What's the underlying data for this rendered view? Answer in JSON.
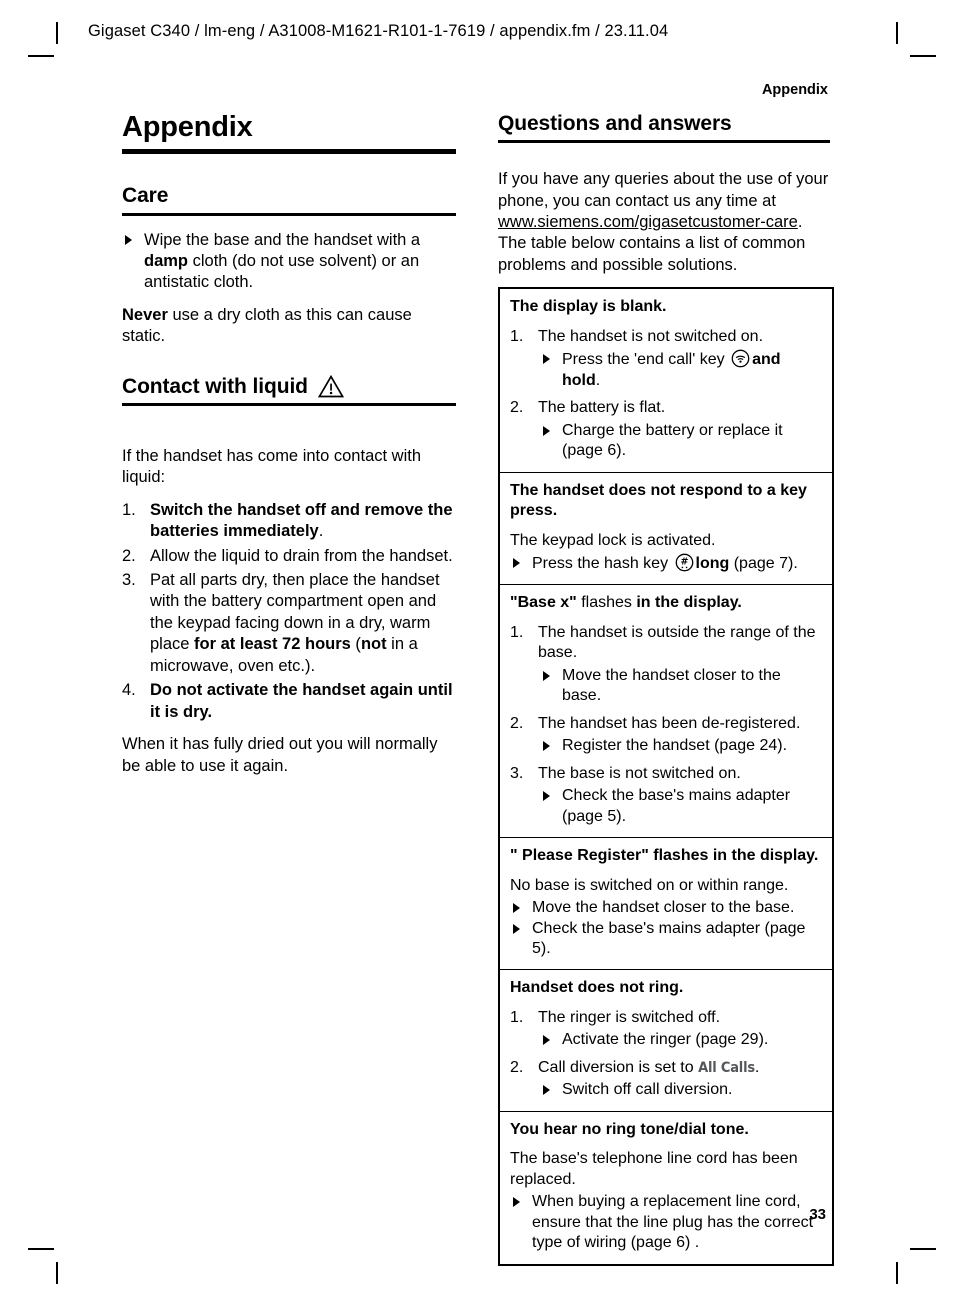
{
  "page": {
    "doc_header": "Gigaset C340 / lm-eng / A31008-M1621-R101-1-7619 / appendix.fm / 23.11.04",
    "running_head": "Appendix",
    "page_number": "33"
  },
  "left_column": {
    "h1": "Appendix",
    "care": {
      "heading": "Care",
      "bullet": {
        "pre": "Wipe the base and the handset with a ",
        "bold": "damp",
        "post": " cloth (do not use solvent) or an antistatic cloth."
      },
      "never": {
        "bold": "Never",
        "post": " use a dry cloth as this can cause static."
      }
    },
    "liquid": {
      "heading": "Contact with liquid",
      "warning_icon": "warning-triangle-icon",
      "intro": "If the handset has come into contact with liquid:",
      "steps": [
        {
          "num": "1.",
          "bold": "Switch the handset off and remove the batteries immediately",
          "post": "."
        },
        {
          "num": "2.",
          "bold": "",
          "post": "Allow the liquid to drain from the handset."
        },
        {
          "num": "3.",
          "bold": "",
          "post": "Pat all parts dry, then place the handset with the battery compartment open and the keypad facing down in a dry, warm place "
        },
        {
          "num": "4.",
          "bold": "Do not activate the handset again until it is dry.",
          "post": ""
        }
      ],
      "step3_bold_a": "for at least 72 hours",
      "step3_mid": " (",
      "step3_bold_b": "not",
      "step3_tail": " in a microwave, oven etc.).",
      "closing": "When it has fully dried out you will normally be able to use it again."
    }
  },
  "right_column": {
    "heading": "Questions and answers",
    "intro": {
      "pre": "If you have any queries about the use of your phone, you can contact us any time at ",
      "link": "www.siemens.com/gigasetcustomer-care",
      "post": ". The table below contains a list of common problems and possible solutions."
    },
    "qa_rows": [
      {
        "title": "The display is blank.",
        "title_plain": "",
        "items": [
          {
            "num": "1.",
            "text": "The handset is not switched on.",
            "subs": [
              {
                "pre": "Press the 'end call' key ",
                "icon": "end-call-key-icon",
                "bold": "and hold",
                "post": "."
              }
            ]
          },
          {
            "num": "2.",
            "text": "The battery is flat.",
            "subs": [
              {
                "pre": "Charge the battery or replace it (page 6).",
                "icon": "",
                "bold": "",
                "post": ""
              }
            ]
          }
        ]
      },
      {
        "title": "The handset does not respond to a key press.",
        "plain": "The keypad lock is activated.",
        "flat_subs": [
          {
            "pre": "Press the hash key ",
            "icon": "hash-key-icon",
            "bold": "long",
            "post": " (page 7)."
          }
        ]
      },
      {
        "title_quoted": "\"Base x\"",
        "title_reg": " flashes ",
        "title_rest": "in the display.",
        "items": [
          {
            "num": "1.",
            "text": "The handset is outside the range of the base.",
            "subs": [
              {
                "pre": "Move the handset closer to the base.",
                "icon": "",
                "bold": "",
                "post": ""
              }
            ]
          },
          {
            "num": "2.",
            "text": "The handset has been de-registered.",
            "subs": [
              {
                "pre": "Register the handset (page 24).",
                "icon": "",
                "bold": "",
                "post": ""
              }
            ]
          },
          {
            "num": "3.",
            "text": "The base is not switched on.",
            "subs": [
              {
                "pre": "Check the base's mains adapter (page 5).",
                "icon": "",
                "bold": "",
                "post": ""
              }
            ]
          }
        ]
      },
      {
        "title": "\" Please Register\" flashes in the display.",
        "plain": "No base is switched on or within range.",
        "flat_subs": [
          {
            "pre": "Move the handset closer to the base.",
            "icon": "",
            "bold": "",
            "post": ""
          },
          {
            "pre": "Check the base's mains adapter (page 5).",
            "icon": "",
            "bold": "",
            "post": ""
          }
        ]
      },
      {
        "title": "Handset does not ring.",
        "items": [
          {
            "num": "1.",
            "text": "The ringer is switched off.",
            "subs": [
              {
                "pre": "Activate the ringer (page 29).",
                "icon": "",
                "bold": "",
                "post": ""
              }
            ]
          },
          {
            "num": "2.",
            "text_pre": "Call diversion is set to ",
            "lcd": "All Calls",
            "text_post": ".",
            "subs": [
              {
                "pre": "Switch off call diversion.",
                "icon": "",
                "bold": "",
                "post": ""
              }
            ]
          }
        ]
      },
      {
        "title": "You hear no ring tone/dial tone.",
        "plain": "The base's telephone line cord has been replaced.",
        "flat_subs": [
          {
            "pre": "When buying a replacement line cord, ensure that the line plug has the correct type of wiring (page 6) .",
            "icon": "",
            "bold": "",
            "post": ""
          }
        ]
      }
    ]
  }
}
